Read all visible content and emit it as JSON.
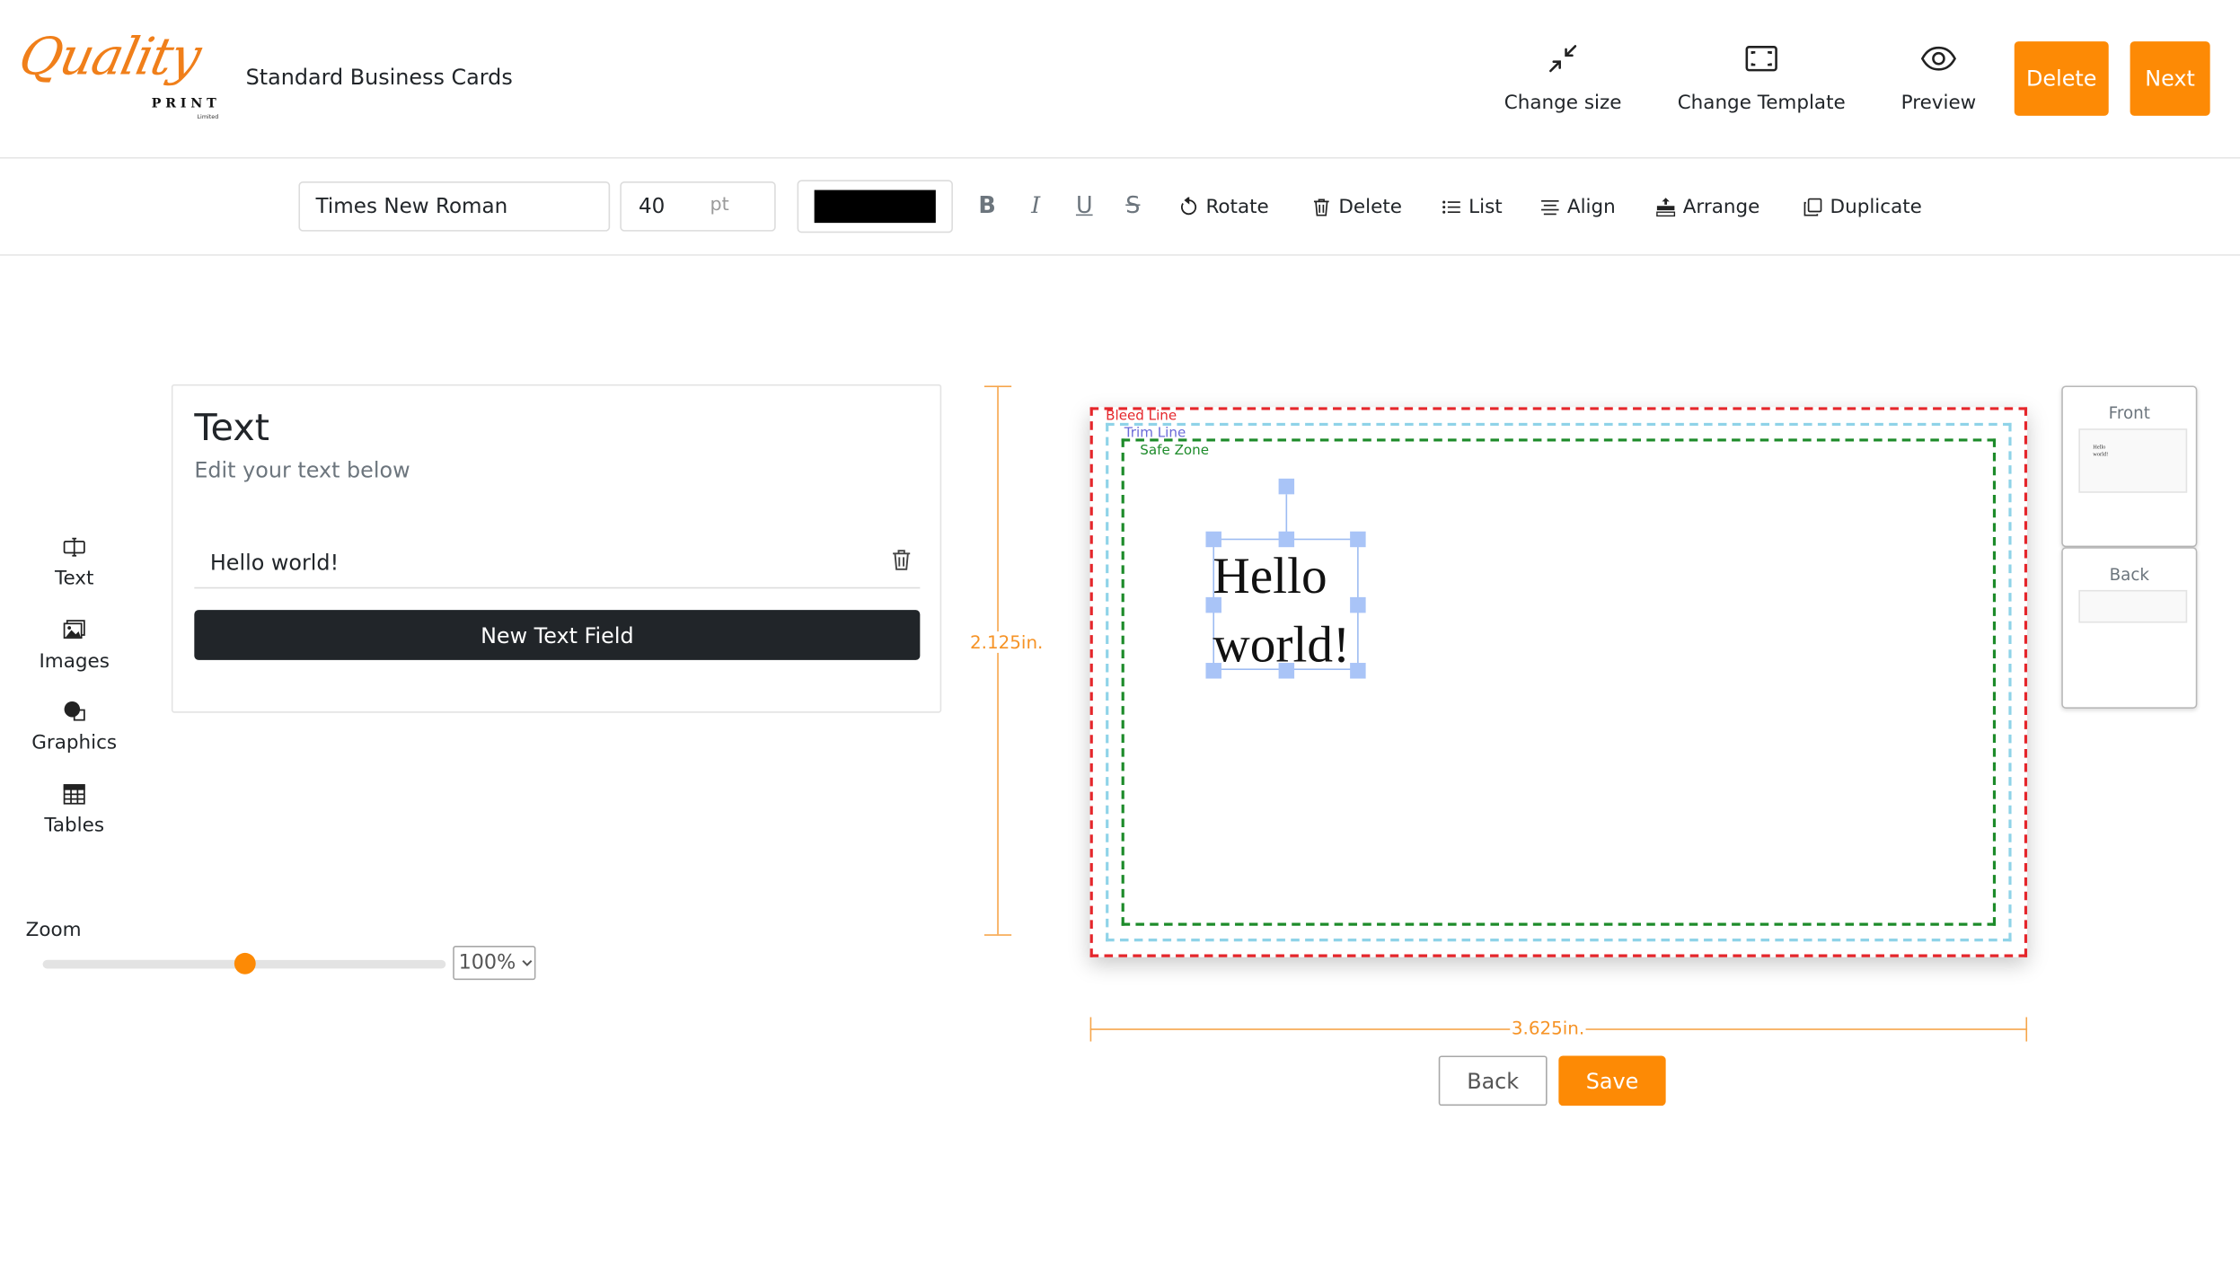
{
  "header": {
    "logo": {
      "script_text": "Quality",
      "print_text": "PRINT",
      "limited_text": "Limited"
    },
    "product_title": "Standard Business Cards",
    "actions": [
      {
        "label": "Change size",
        "icon": "minimize-arrows-icon"
      },
      {
        "label": "Change Template",
        "icon": "template-frame-icon"
      },
      {
        "label": "Preview",
        "icon": "eye-icon"
      }
    ],
    "delete_label": "Delete",
    "next_label": "Next",
    "accent_color": "#fd8a05"
  },
  "toolbar": {
    "font_family": "Times New Roman",
    "font_size": "40",
    "font_unit": "pt",
    "text_color": "#000000",
    "format_buttons": {
      "bold": "B",
      "italic": "I",
      "underline": "U",
      "strike": "S"
    },
    "items": [
      {
        "label": "Rotate",
        "icon": "rotate-icon"
      },
      {
        "label": "Delete",
        "icon": "trash-icon"
      },
      {
        "label": "List",
        "icon": "list-icon"
      },
      {
        "label": "Align",
        "icon": "align-icon"
      },
      {
        "label": "Arrange",
        "icon": "arrange-icon"
      },
      {
        "label": "Duplicate",
        "icon": "duplicate-icon"
      }
    ]
  },
  "sidebar": {
    "items": [
      {
        "label": "Text",
        "icon": "text-icon"
      },
      {
        "label": "Images",
        "icon": "image-icon"
      },
      {
        "label": "Graphics",
        "icon": "shapes-icon"
      },
      {
        "label": "Tables",
        "icon": "table-icon"
      }
    ],
    "zoom": {
      "label": "Zoom",
      "value": "100%",
      "level_fraction": 0.5
    }
  },
  "text_panel": {
    "title": "Text",
    "subtitle": "Edit your text below",
    "fields": [
      {
        "value": "Hello world!"
      }
    ],
    "new_field_label": "New Text Field"
  },
  "canvas": {
    "height_label": "2.125in.",
    "width_label": "3.625in.",
    "bleed_label": "Bleed Line",
    "trim_label": "Trim Line",
    "safe_label": "Safe Zone",
    "bleed_color": "#e5262b",
    "trim_color": "#8fd3e8",
    "safe_color": "#1d8b2a",
    "text_lines": [
      "Hello",
      "world!"
    ]
  },
  "footer": {
    "back_label": "Back",
    "save_label": "Save"
  },
  "pages": {
    "front_label": "Front",
    "back_label": "Back",
    "front_preview_lines": [
      "Hello",
      "world!"
    ]
  }
}
